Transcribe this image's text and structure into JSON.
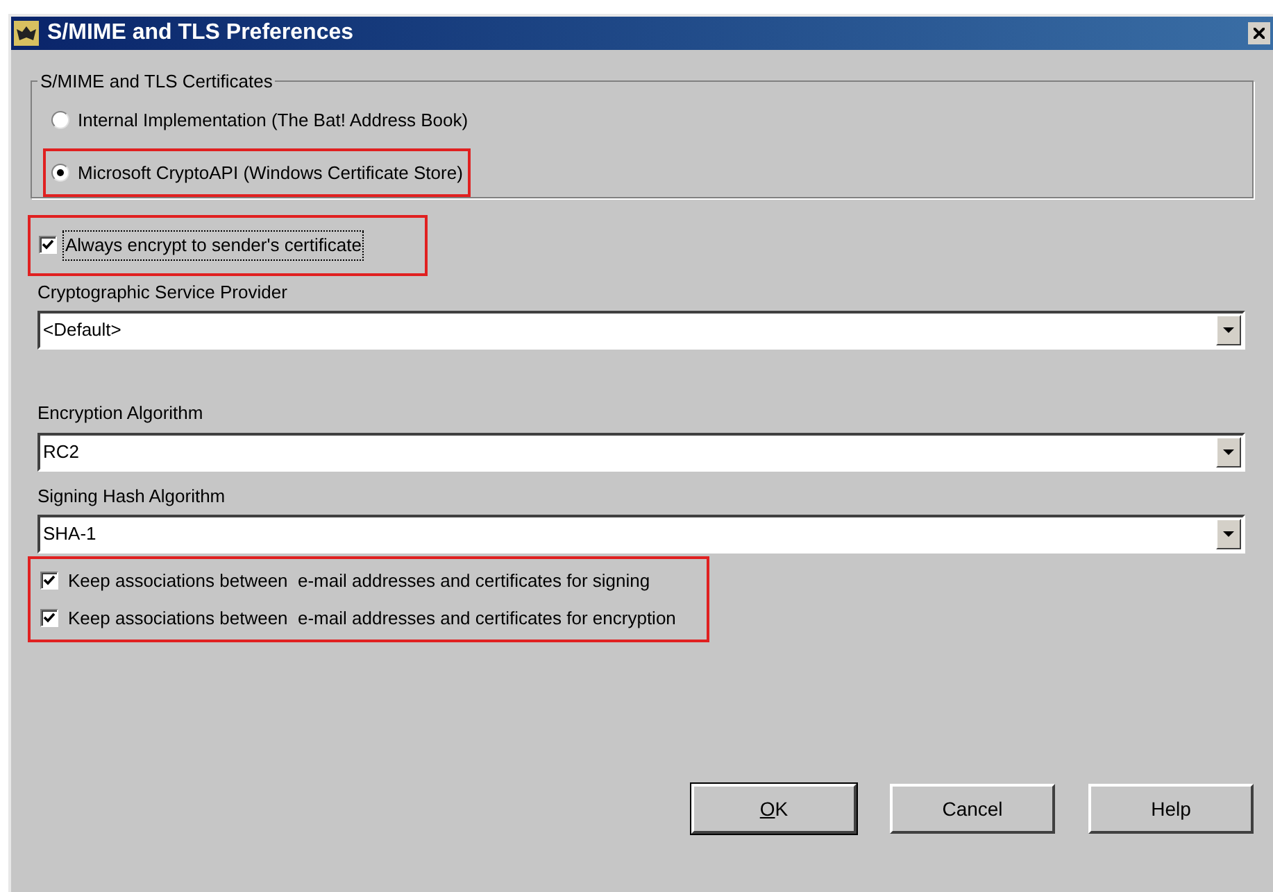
{
  "window": {
    "title": "S/MIME and TLS Preferences"
  },
  "certificates": {
    "legend": "S/MIME and TLS Certificates",
    "options": [
      {
        "label": "Internal Implementation (The Bat! Address Book)",
        "selected": false,
        "highlighted": false
      },
      {
        "label": "Microsoft CryptoAPI (Windows Certificate Store)",
        "selected": true,
        "highlighted": true
      }
    ]
  },
  "always_encrypt": {
    "label": "Always encrypt to sender's certificate",
    "checked": true,
    "focused": true,
    "highlighted": true
  },
  "dropdowns": [
    {
      "label": "Cryptographic Service Provider",
      "value": "<Default>"
    },
    {
      "label": "Encryption Algorithm",
      "value": "RC2"
    },
    {
      "label": "Signing Hash Algorithm",
      "value": "SHA-1"
    }
  ],
  "associations": {
    "highlighted": true,
    "options": [
      {
        "label": "Keep associations between  e-mail addresses and certificates for signing",
        "checked": true
      },
      {
        "label": "Keep associations between  e-mail addresses and certificates for encryption",
        "checked": true
      }
    ]
  },
  "buttons": [
    {
      "label": "OK",
      "underline_first": true,
      "default": true
    },
    {
      "label": "Cancel",
      "underline_first": false,
      "default": false
    },
    {
      "label": "Help",
      "underline_first": false,
      "default": false
    }
  ]
}
